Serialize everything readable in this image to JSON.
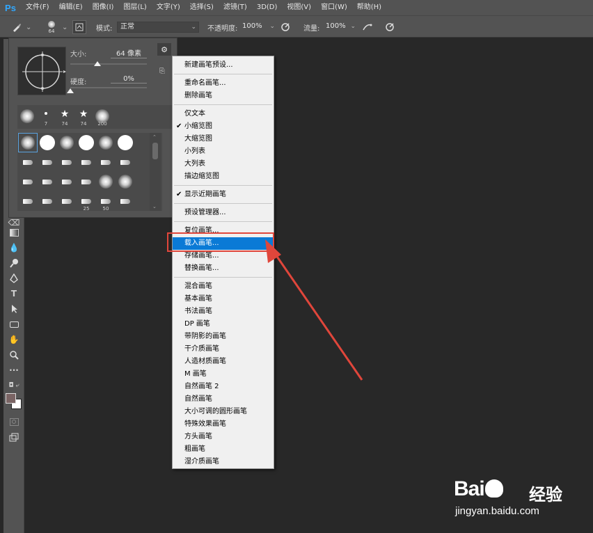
{
  "app": {
    "logo": "Ps",
    "menu": [
      "文件(F)",
      "编辑(E)",
      "图像(I)",
      "图层(L)",
      "文字(Y)",
      "选择(S)",
      "滤镜(T)",
      "3D(D)",
      "视图(V)",
      "窗口(W)",
      "帮助(H)"
    ]
  },
  "options_bar": {
    "brush_size": "64",
    "mode_label": "模式:",
    "mode_value": "正常",
    "opacity_label": "不透明度:",
    "opacity_value": "100%",
    "flow_label": "流量:",
    "flow_value": "100%"
  },
  "brush_panel": {
    "size_label": "大小:",
    "size_value": "64 像素",
    "size_fraction": 0.35,
    "hardness_label": "硬度:",
    "hardness_value": "0%",
    "hardness_fraction": 0.0,
    "recent": [
      {
        "kind": "soft",
        "label": ""
      },
      {
        "kind": "dot",
        "label": "7"
      },
      {
        "kind": "star",
        "label": "74"
      },
      {
        "kind": "star",
        "label": "74"
      },
      {
        "kind": "soft",
        "label": "200"
      }
    ],
    "grid": [
      [
        "soft",
        "hard",
        "soft",
        "hard",
        "soft",
        "hard"
      ],
      [
        "tip",
        "tip",
        "tip",
        "tip",
        "tip",
        "tip"
      ],
      [
        "tip",
        "tip",
        "tip",
        "tip",
        "soft",
        "soft"
      ],
      [
        "tip",
        "tip",
        "tip",
        "tip",
        "tip",
        "tip"
      ]
    ],
    "grid_labels": [
      "",
      "",
      "",
      "25",
      "50",
      ""
    ]
  },
  "context_menu": {
    "groups": [
      [
        "新建画笔预设..."
      ],
      [
        "重命名画笔...",
        "删除画笔"
      ],
      [
        "仅文本",
        "小缩览图",
        "大缩览图",
        "小列表",
        "大列表",
        "描边缩览图"
      ],
      [
        "显示近期画笔"
      ],
      [
        "预设管理器..."
      ],
      [
        "复位画笔...",
        "载入画笔...",
        "存储画笔...",
        "替换画笔..."
      ],
      [
        "混合画笔",
        "基本画笔",
        "书法画笔",
        "DP 画笔",
        "带阴影的画笔",
        "干介质画笔",
        "人造材质画笔",
        "M 画笔",
        "自然画笔 2",
        "自然画笔",
        "大小可调的圆形画笔",
        "特殊效果画笔",
        "方头画笔",
        "粗画笔",
        "湿介质画笔"
      ]
    ],
    "checked": [
      "小缩览图",
      "显示近期画笔"
    ],
    "highlighted": "载入画笔..."
  },
  "watermark": {
    "brand": "Bai",
    "brand_cn": "经验",
    "url": "jingyan.baidu.com"
  },
  "colors": {
    "accent": "#0a7ad6",
    "annotation": "#e0463b",
    "foreground_swatch": "#7a6464",
    "background_swatch": "#ffffff"
  }
}
